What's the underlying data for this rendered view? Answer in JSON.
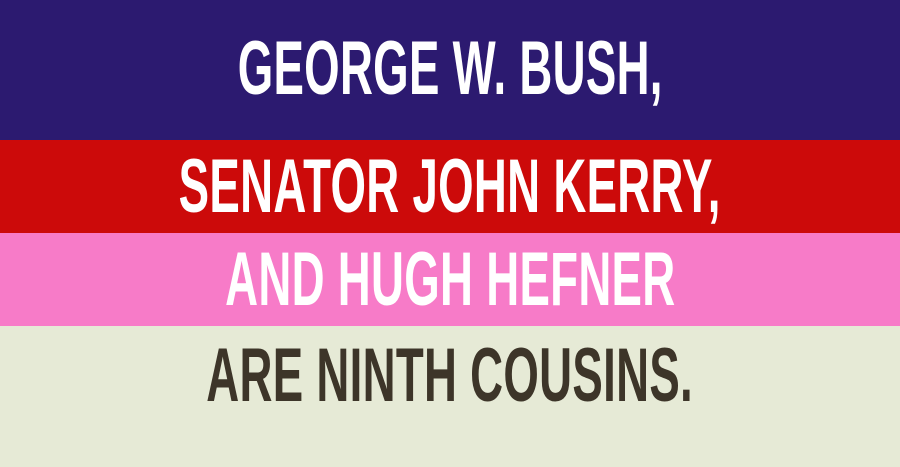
{
  "lines": [
    {
      "text": "GEORGE W. BUSH,",
      "background": "#2c1a70",
      "color": "#ffffff"
    },
    {
      "text": "SENATOR JOHN KERRY,",
      "background": "#cc0a0a",
      "color": "#ffffff"
    },
    {
      "text": "AND HUGH HEFNER",
      "background": "#f77bc8",
      "color": "#ffffff"
    },
    {
      "text": "ARE NINTH COUSINS.",
      "background": "#e6ead6",
      "color": "#3d3529"
    }
  ]
}
